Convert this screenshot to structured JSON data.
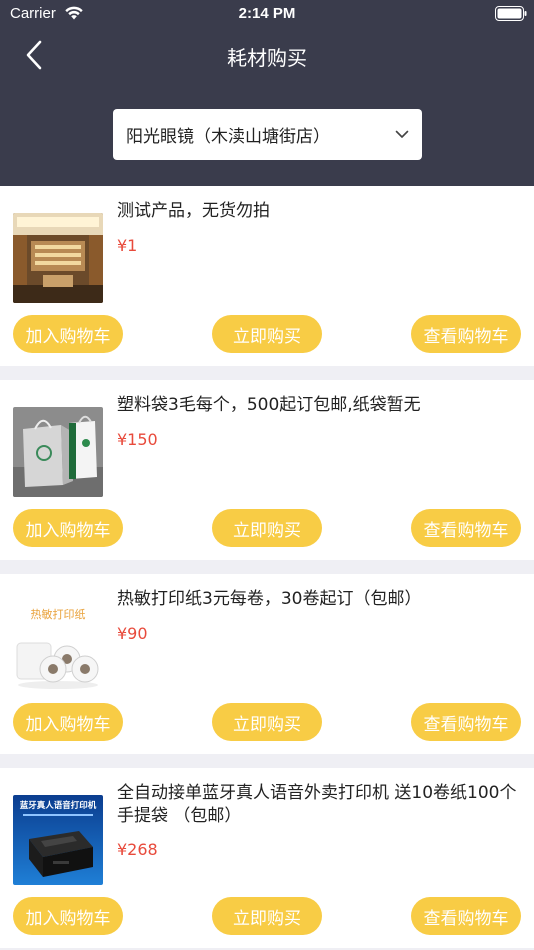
{
  "status_bar": {
    "carrier": "Carrier",
    "time": "2:14 PM"
  },
  "nav": {
    "title": "耗材购买"
  },
  "store_selector": {
    "selected": "阳光眼镜（木渎山塘街店）"
  },
  "buttons": {
    "add_to_cart": "加入购物车",
    "buy_now": "立即购买",
    "view_cart": "查看购物车"
  },
  "products": [
    {
      "title": "测试产品，无货勿拍",
      "price": "¥1"
    },
    {
      "title": "塑料袋3毛每个，500起订包邮,纸袋暂无",
      "price": "¥150"
    },
    {
      "title": "热敏打印纸3元每卷，30卷起订（包邮）",
      "price": "¥90",
      "image_text": "热敏打印纸"
    },
    {
      "title": "全自动接单蓝牙真人语音外卖打印机 送10卷纸100个手提袋 （包邮）",
      "price": "¥268",
      "image_text": "蓝牙真人语音打印机"
    }
  ],
  "colors": {
    "header_bg": "#3a3c4c",
    "accent": "#f8cc45",
    "price": "#e84a3b"
  }
}
